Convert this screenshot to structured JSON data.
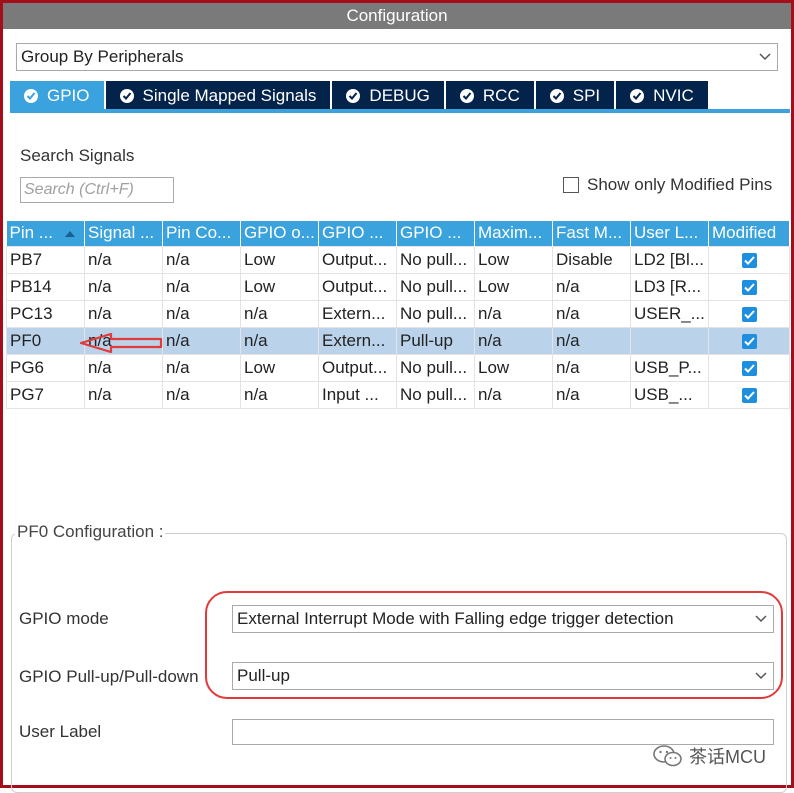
{
  "window": {
    "title": "Configuration"
  },
  "group_by": {
    "value": "Group By Peripherals"
  },
  "tabs": [
    {
      "label": "GPIO",
      "active": true
    },
    {
      "label": "Single Mapped Signals",
      "active": false
    },
    {
      "label": "DEBUG",
      "active": false
    },
    {
      "label": "RCC",
      "active": false
    },
    {
      "label": "SPI",
      "active": false
    },
    {
      "label": "NVIC",
      "active": false
    }
  ],
  "search": {
    "label": "Search Signals",
    "placeholder": "Search (Ctrl+F)"
  },
  "show_modified": {
    "label": "Show only Modified Pins",
    "checked": false
  },
  "table": {
    "columns": [
      "Pin ...",
      "Signal ...",
      "Pin Co...",
      "GPIO o...",
      "GPIO ...",
      "GPIO ...",
      "Maxim...",
      "Fast M...",
      "User L...",
      "Modified"
    ],
    "rows": [
      {
        "cells": [
          "PB7",
          "n/a",
          "n/a",
          "Low",
          "Output...",
          "No pull...",
          "Low",
          "Disable",
          "LD2 [Bl..."
        ],
        "modified": true,
        "selected": false
      },
      {
        "cells": [
          "PB14",
          "n/a",
          "n/a",
          "Low",
          "Output...",
          "No pull...",
          "Low",
          "n/a",
          "LD3 [R..."
        ],
        "modified": true,
        "selected": false
      },
      {
        "cells": [
          "PC13",
          "n/a",
          "n/a",
          "n/a",
          "Extern...",
          "No pull...",
          "n/a",
          "n/a",
          "USER_..."
        ],
        "modified": true,
        "selected": false
      },
      {
        "cells": [
          "PF0",
          "n/a",
          "n/a",
          "n/a",
          "Extern...",
          "Pull-up",
          "n/a",
          "n/a",
          ""
        ],
        "modified": true,
        "selected": true
      },
      {
        "cells": [
          "PG6",
          "n/a",
          "n/a",
          "Low",
          "Output...",
          "No pull...",
          "Low",
          "n/a",
          "USB_P..."
        ],
        "modified": true,
        "selected": false
      },
      {
        "cells": [
          "PG7",
          "n/a",
          "n/a",
          "n/a",
          "Input ...",
          "No pull...",
          "n/a",
          "n/a",
          "USB_..."
        ],
        "modified": true,
        "selected": false
      }
    ]
  },
  "config": {
    "title": "PF0 Configuration :",
    "gpio_mode": {
      "label": "GPIO mode",
      "value": "External Interrupt Mode with Falling edge trigger detection"
    },
    "pull": {
      "label": "GPIO Pull-up/Pull-down",
      "value": "Pull-up"
    },
    "user_label": {
      "label": "User Label",
      "value": ""
    }
  },
  "watermark": {
    "text": "茶话MCU",
    "icon": "wechat-icon"
  },
  "colors": {
    "accent": "#3aa3de",
    "tab_dark": "#03234b",
    "highlight": "#e23a3a",
    "selected_row": "#bad3eb",
    "frame": "#a40d1a"
  }
}
